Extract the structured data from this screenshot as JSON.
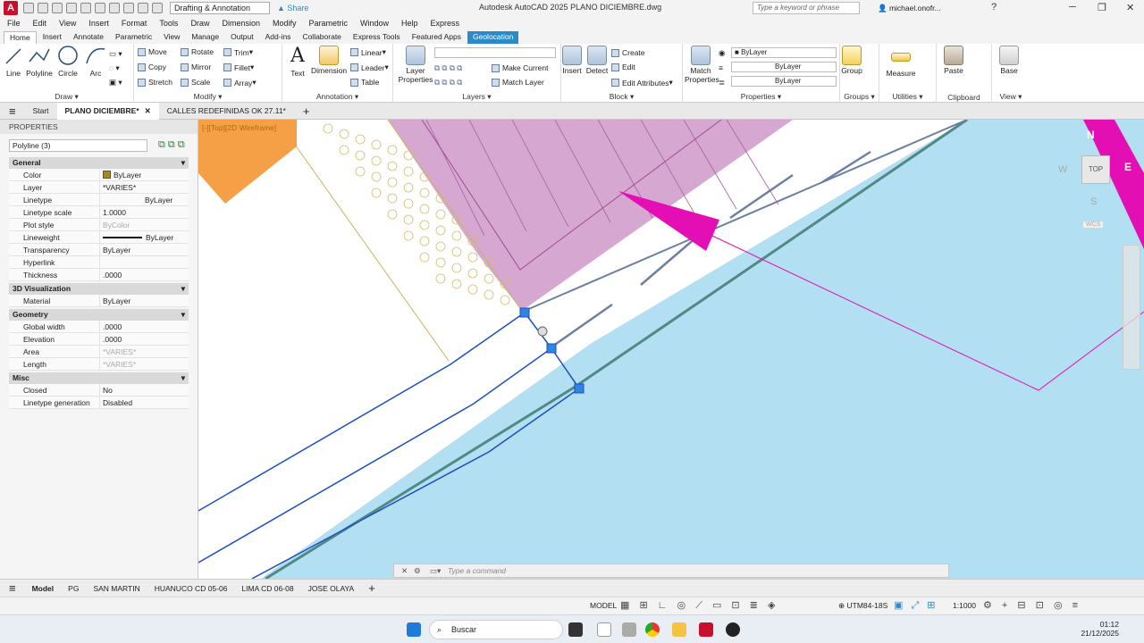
{
  "titlebar": {
    "app_logo": "A",
    "workspace": "Drafting & Annotation",
    "share": "Share",
    "title": "Autodesk AutoCAD 2025    PLANO DICIEMBRE.dwg",
    "search_placeholder": "Type a keyword or phrase",
    "user": "michael.onofr..."
  },
  "menubar": {
    "items": [
      "File",
      "Edit",
      "View",
      "Insert",
      "Format",
      "Tools",
      "Draw",
      "Dimension",
      "Modify",
      "Parametric",
      "Window",
      "Help",
      "Express"
    ]
  },
  "ribbon_tabs": [
    "Home",
    "Insert",
    "Annotate",
    "Parametric",
    "View",
    "Manage",
    "Output",
    "Add-ins",
    "Collaborate",
    "Express Tools",
    "Featured Apps",
    "Geolocation"
  ],
  "ribbon": {
    "draw": {
      "title": "Draw",
      "line": "Line",
      "polyline": "Polyline",
      "circle": "Circle",
      "arc": "Arc"
    },
    "modify": {
      "title": "Modify",
      "move": "Move",
      "rotate": "Rotate",
      "trim": "Trim",
      "copy": "Copy",
      "mirror": "Mirror",
      "fillet": "Fillet",
      "stretch": "Stretch",
      "scale": "Scale",
      "array": "Array"
    },
    "annotation": {
      "title": "Annotation",
      "text": "Text",
      "dimension": "Dimension",
      "linear": "Linear",
      "leader": "Leader",
      "table": "Table"
    },
    "layers": {
      "title": "Layers",
      "layer_properties": "Layer Properties",
      "make_current": "Make Current",
      "match_layer": "Match Layer"
    },
    "block": {
      "title": "Block",
      "insert": "Insert",
      "detect": "Detect",
      "create": "Create",
      "edit": "Edit",
      "edit_attributes": "Edit Attributes"
    },
    "properties": {
      "title": "Properties",
      "match_properties": "Match Properties",
      "color": "ByLayer",
      "linetype": "ByLayer",
      "lineweight": "ByLayer"
    },
    "groups": {
      "title": "Groups",
      "group": "Group"
    },
    "utilities": {
      "title": "Utilities",
      "measure": "Measure"
    },
    "clipboard": {
      "title": "Clipboard",
      "paste": "Paste"
    },
    "view": {
      "title": "View",
      "base": "Base"
    }
  },
  "doc_tabs": [
    "Start",
    "PLANO DICIEMBRE*",
    "CALLES REDEFINIDAS OK 27.11*"
  ],
  "properties_panel": {
    "header": "PROPERTIES",
    "selection": "Polyline (3)",
    "sections": [
      {
        "title": "General",
        "rows": [
          [
            "Color",
            "ByLayer"
          ],
          [
            "Layer",
            "*VARIES*"
          ],
          [
            "Linetype",
            "ByLayer"
          ],
          [
            "Linetype scale",
            "1.0000"
          ],
          [
            "Plot style",
            "ByColor"
          ],
          [
            "Lineweight",
            "ByLayer"
          ],
          [
            "Transparency",
            "ByLayer"
          ],
          [
            "Hyperlink",
            ""
          ],
          [
            "Thickness",
            ".0000"
          ]
        ]
      },
      {
        "title": "3D Visualization",
        "rows": [
          [
            "Material",
            "ByLayer"
          ]
        ]
      },
      {
        "title": "Geometry",
        "rows": [
          [
            "Global width",
            ".0000"
          ],
          [
            "Elevation",
            ".0000"
          ],
          [
            "Area",
            "*VARIES*"
          ],
          [
            "Length",
            "*VARIES*"
          ]
        ]
      },
      {
        "title": "Misc",
        "rows": [
          [
            "Closed",
            "No"
          ],
          [
            "Linetype generation",
            "Disabled"
          ]
        ]
      }
    ]
  },
  "viewport": {
    "label": "[-][Top][2D Wireframe]",
    "compass": {
      "n": "N",
      "e": "E",
      "w": "W",
      "s": "S",
      "top": "TOP"
    },
    "wcs": "WCS"
  },
  "command": {
    "placeholder": "Type a command"
  },
  "layout_tabs": [
    "Model",
    "PG",
    "SAN MARTIN",
    "HUANUCO CD 05-06",
    "LIMA CD 06-08",
    "JOSE OLAYA"
  ],
  "status": {
    "model": "MODEL",
    "coord_system": "UTM84-18S",
    "scale": "1:1000"
  },
  "taskbar": {
    "search": "Buscar",
    "time": "01:12",
    "date": "21/12/2025"
  },
  "colors": {
    "water": "#b3dff2",
    "parcel": "#d6a8d1",
    "orange": "#f59f47",
    "polyline": "#1c4fc3",
    "magenta": "#e40fb4",
    "ribbon_geo": "#2b8bc8"
  }
}
